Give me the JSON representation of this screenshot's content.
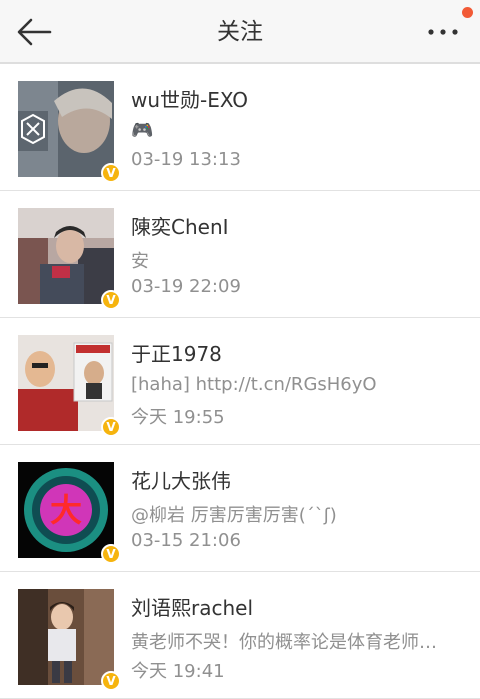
{
  "header": {
    "title": "关注"
  },
  "colors": {
    "badge": "#f6b40e",
    "notify_dot": "#f25a36",
    "secondary_text": "#909090"
  },
  "rows": [
    {
      "name": "wu世勋-EXO",
      "message": "🎮",
      "time": "03-19 13:13",
      "badge": "V"
    },
    {
      "name": "陳奕ChenI",
      "message": "安",
      "time": "03-19 22:09",
      "badge": "V"
    },
    {
      "name": "于正1978",
      "message": "[haha] http://t.cn/RGsH6yO",
      "time": "今天 19:55",
      "badge": "V"
    },
    {
      "name": "花儿大张伟",
      "message": "@柳岩 厉害厉害厉害(´`ʃ)",
      "time": "03-15 21:06",
      "badge": "V",
      "avatar_text": "大"
    },
    {
      "name": "刘语熙rachel",
      "message": "黄老师不哭！你的概率论是体育老师…",
      "time": "今天 19:41",
      "badge": "V"
    }
  ]
}
